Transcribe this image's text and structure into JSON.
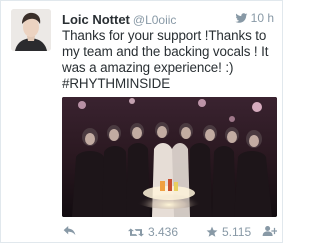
{
  "tweet": {
    "author_name": "Loic Nottet",
    "author_handle": "@L0oiic",
    "time": "10 h",
    "text": "Thanks for your support !Thanks to my team and the backing vocals ! It was a amazing experience! :)\n#RHYTHMINSIDE"
  },
  "stats": {
    "retweets": "3.436",
    "favorites": "5.115"
  },
  "icons": {
    "verified": "twitter-bird-icon",
    "reply": "reply-icon",
    "retweet": "retweet-icon",
    "favorite": "star-icon",
    "follow": "add-user-icon"
  },
  "colors": {
    "text": "#292f33",
    "muted": "#8899a6",
    "border": "#e1e8ed"
  }
}
